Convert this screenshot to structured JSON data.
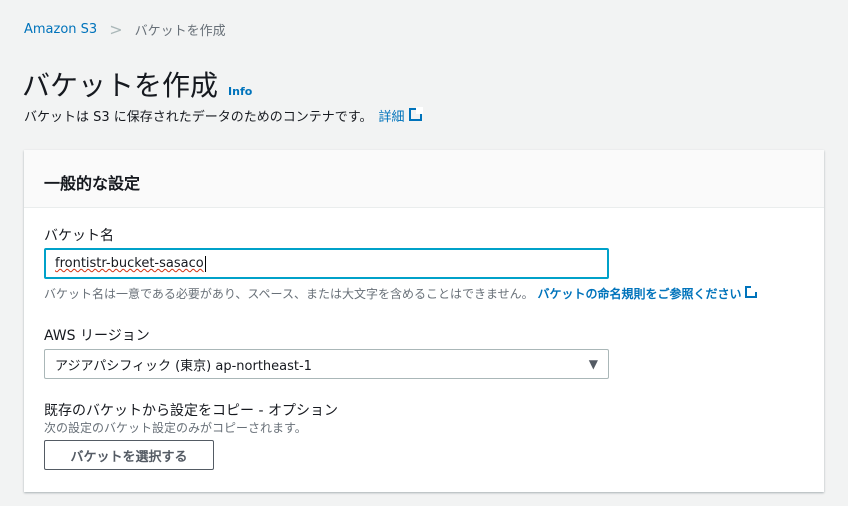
{
  "breadcrumb": {
    "root": "Amazon S3",
    "current": "バケットを作成"
  },
  "header": {
    "title": "バケットを作成",
    "info": "Info",
    "description": "バケットは S3 に保存されたデータのためのコンテナです。",
    "details_link": "詳細"
  },
  "general": {
    "title": "一般的な設定",
    "bucket_name_label": "バケット名",
    "bucket_name_value": "frontistr-bucket-sasaco",
    "bucket_name_hint": "バケット名は一意である必要があり、スペース、または大文字を含めることはできません。",
    "naming_rules_link": "バケットの命名規則をご参照ください",
    "region_label": "AWS リージョン",
    "region_value": "アジアパシフィック (東京) ap-northeast-1",
    "copy_label": "既存のバケットから設定をコピー - オプション",
    "copy_sub": "次の設定のバケット設定のみがコピーされます。",
    "choose_bucket_button": "バケットを選択する"
  }
}
